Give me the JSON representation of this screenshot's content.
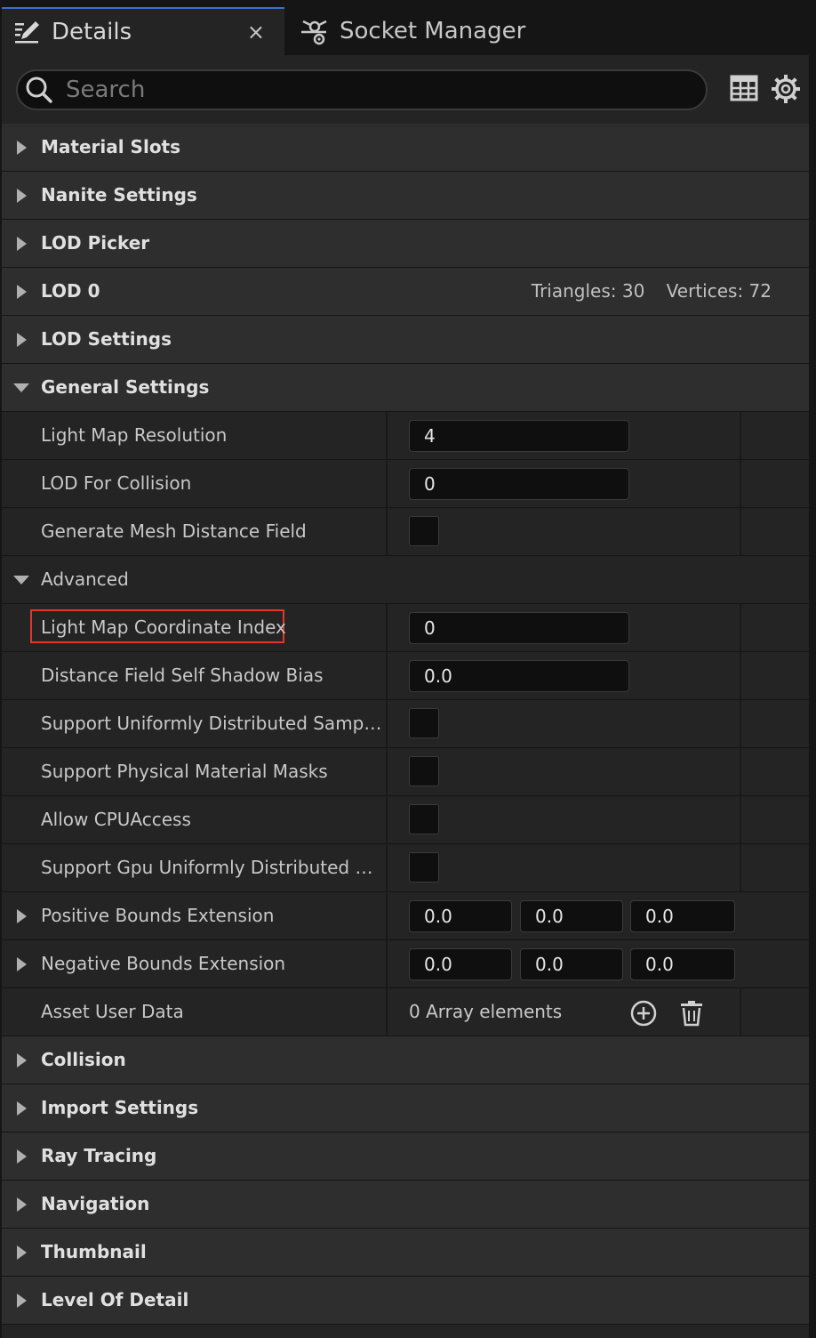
{
  "tabs": {
    "details": "Details",
    "socket_manager": "Socket Manager",
    "close": "×"
  },
  "search": {
    "placeholder": "Search"
  },
  "categories_top": [
    "Material Slots",
    "Nanite Settings",
    "LOD Picker",
    "LOD 0",
    "LOD Settings",
    "General Settings"
  ],
  "lod0_stats": {
    "triangles": "Triangles: 30",
    "vertices": "Vertices: 72"
  },
  "general": {
    "light_map_resolution": {
      "label": "Light Map Resolution",
      "value": "4"
    },
    "lod_for_collision": {
      "label": "LOD For Collision",
      "value": "0"
    },
    "generate_mesh_distance_field": {
      "label": "Generate Mesh Distance Field",
      "checked": false
    }
  },
  "advanced": {
    "label": "Advanced",
    "light_map_coordinate_index": {
      "label": "Light Map Coordinate Index",
      "value": "0"
    },
    "distance_field_self_shadow_bias": {
      "label": "Distance Field Self Shadow Bias",
      "value": "0.0"
    },
    "support_uniformly_distributed_sampling": {
      "label": "Support Uniformly Distributed Sampling",
      "checked": false
    },
    "support_physical_material_masks": {
      "label": "Support Physical Material Masks",
      "checked": false
    },
    "allow_cpu_access": {
      "label": "Allow CPUAccess",
      "checked": false
    },
    "support_gpu_uniformly_distributed_sampling": {
      "label": "Support Gpu Uniformly Distributed Sam...",
      "checked": false
    },
    "positive_bounds_extension": {
      "label": "Positive Bounds Extension",
      "x": "0.0",
      "y": "0.0",
      "z": "0.0"
    },
    "negative_bounds_extension": {
      "label": "Negative Bounds Extension",
      "x": "0.0",
      "y": "0.0",
      "z": "0.0"
    },
    "asset_user_data": {
      "label": "Asset User Data",
      "value": "0 Array elements"
    }
  },
  "categories_bottom": [
    "Collision",
    "Import Settings",
    "Ray Tracing",
    "Navigation",
    "Thumbnail",
    "Level Of Detail"
  ],
  "colors": {
    "panel_bg": "#242424",
    "category_bg": "#2e2e2e",
    "input_bg": "#0f0f0f",
    "highlight": "#e0392b",
    "tab_accent": "#3d6fd0"
  }
}
